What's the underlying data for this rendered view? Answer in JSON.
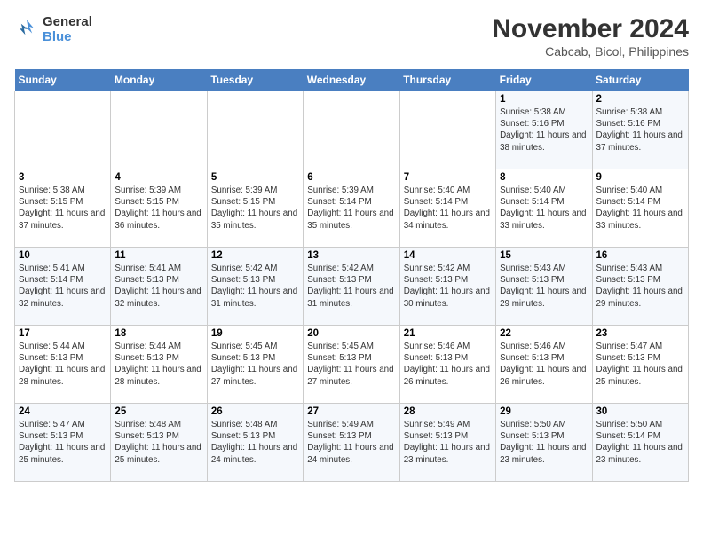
{
  "header": {
    "logo_line1": "General",
    "logo_line2": "Blue",
    "title": "November 2024",
    "subtitle": "Cabcab, Bicol, Philippines"
  },
  "days_of_week": [
    "Sunday",
    "Monday",
    "Tuesday",
    "Wednesday",
    "Thursday",
    "Friday",
    "Saturday"
  ],
  "weeks": [
    [
      {
        "day": "",
        "info": ""
      },
      {
        "day": "",
        "info": ""
      },
      {
        "day": "",
        "info": ""
      },
      {
        "day": "",
        "info": ""
      },
      {
        "day": "",
        "info": ""
      },
      {
        "day": "1",
        "info": "Sunrise: 5:38 AM\nSunset: 5:16 PM\nDaylight: 11 hours and 38 minutes."
      },
      {
        "day": "2",
        "info": "Sunrise: 5:38 AM\nSunset: 5:16 PM\nDaylight: 11 hours and 37 minutes."
      }
    ],
    [
      {
        "day": "3",
        "info": "Sunrise: 5:38 AM\nSunset: 5:15 PM\nDaylight: 11 hours and 37 minutes."
      },
      {
        "day": "4",
        "info": "Sunrise: 5:39 AM\nSunset: 5:15 PM\nDaylight: 11 hours and 36 minutes."
      },
      {
        "day": "5",
        "info": "Sunrise: 5:39 AM\nSunset: 5:15 PM\nDaylight: 11 hours and 35 minutes."
      },
      {
        "day": "6",
        "info": "Sunrise: 5:39 AM\nSunset: 5:14 PM\nDaylight: 11 hours and 35 minutes."
      },
      {
        "day": "7",
        "info": "Sunrise: 5:40 AM\nSunset: 5:14 PM\nDaylight: 11 hours and 34 minutes."
      },
      {
        "day": "8",
        "info": "Sunrise: 5:40 AM\nSunset: 5:14 PM\nDaylight: 11 hours and 33 minutes."
      },
      {
        "day": "9",
        "info": "Sunrise: 5:40 AM\nSunset: 5:14 PM\nDaylight: 11 hours and 33 minutes."
      }
    ],
    [
      {
        "day": "10",
        "info": "Sunrise: 5:41 AM\nSunset: 5:14 PM\nDaylight: 11 hours and 32 minutes."
      },
      {
        "day": "11",
        "info": "Sunrise: 5:41 AM\nSunset: 5:13 PM\nDaylight: 11 hours and 32 minutes."
      },
      {
        "day": "12",
        "info": "Sunrise: 5:42 AM\nSunset: 5:13 PM\nDaylight: 11 hours and 31 minutes."
      },
      {
        "day": "13",
        "info": "Sunrise: 5:42 AM\nSunset: 5:13 PM\nDaylight: 11 hours and 31 minutes."
      },
      {
        "day": "14",
        "info": "Sunrise: 5:42 AM\nSunset: 5:13 PM\nDaylight: 11 hours and 30 minutes."
      },
      {
        "day": "15",
        "info": "Sunrise: 5:43 AM\nSunset: 5:13 PM\nDaylight: 11 hours and 29 minutes."
      },
      {
        "day": "16",
        "info": "Sunrise: 5:43 AM\nSunset: 5:13 PM\nDaylight: 11 hours and 29 minutes."
      }
    ],
    [
      {
        "day": "17",
        "info": "Sunrise: 5:44 AM\nSunset: 5:13 PM\nDaylight: 11 hours and 28 minutes."
      },
      {
        "day": "18",
        "info": "Sunrise: 5:44 AM\nSunset: 5:13 PM\nDaylight: 11 hours and 28 minutes."
      },
      {
        "day": "19",
        "info": "Sunrise: 5:45 AM\nSunset: 5:13 PM\nDaylight: 11 hours and 27 minutes."
      },
      {
        "day": "20",
        "info": "Sunrise: 5:45 AM\nSunset: 5:13 PM\nDaylight: 11 hours and 27 minutes."
      },
      {
        "day": "21",
        "info": "Sunrise: 5:46 AM\nSunset: 5:13 PM\nDaylight: 11 hours and 26 minutes."
      },
      {
        "day": "22",
        "info": "Sunrise: 5:46 AM\nSunset: 5:13 PM\nDaylight: 11 hours and 26 minutes."
      },
      {
        "day": "23",
        "info": "Sunrise: 5:47 AM\nSunset: 5:13 PM\nDaylight: 11 hours and 25 minutes."
      }
    ],
    [
      {
        "day": "24",
        "info": "Sunrise: 5:47 AM\nSunset: 5:13 PM\nDaylight: 11 hours and 25 minutes."
      },
      {
        "day": "25",
        "info": "Sunrise: 5:48 AM\nSunset: 5:13 PM\nDaylight: 11 hours and 25 minutes."
      },
      {
        "day": "26",
        "info": "Sunrise: 5:48 AM\nSunset: 5:13 PM\nDaylight: 11 hours and 24 minutes."
      },
      {
        "day": "27",
        "info": "Sunrise: 5:49 AM\nSunset: 5:13 PM\nDaylight: 11 hours and 24 minutes."
      },
      {
        "day": "28",
        "info": "Sunrise: 5:49 AM\nSunset: 5:13 PM\nDaylight: 11 hours and 23 minutes."
      },
      {
        "day": "29",
        "info": "Sunrise: 5:50 AM\nSunset: 5:13 PM\nDaylight: 11 hours and 23 minutes."
      },
      {
        "day": "30",
        "info": "Sunrise: 5:50 AM\nSunset: 5:14 PM\nDaylight: 11 hours and 23 minutes."
      }
    ]
  ]
}
